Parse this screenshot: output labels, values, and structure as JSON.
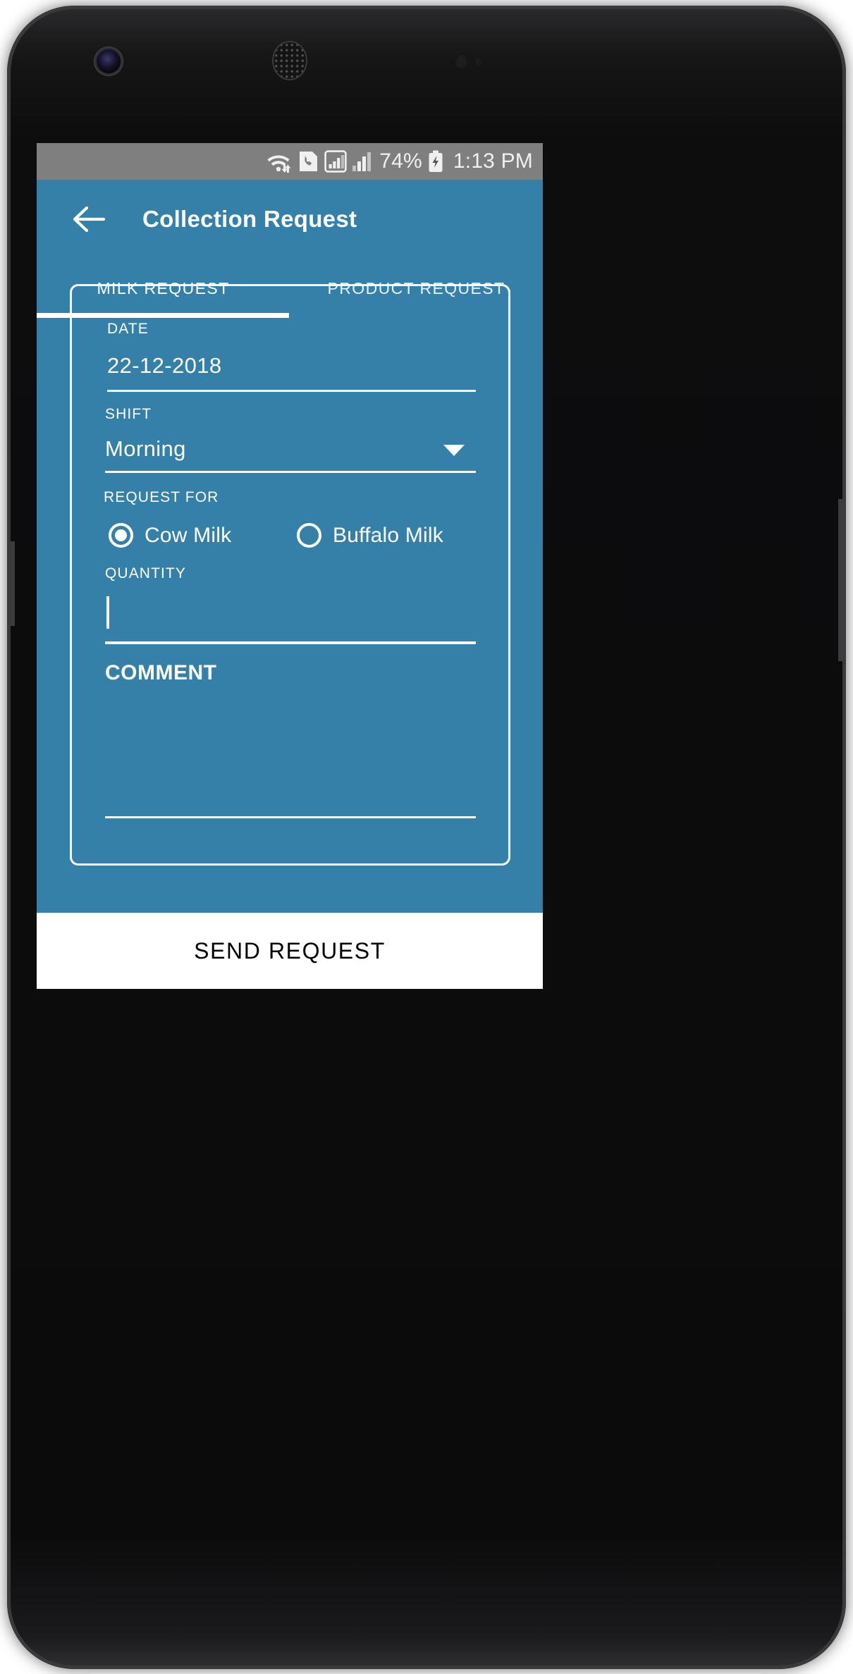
{
  "device": {
    "hardware": {
      "front_camera": "front-camera",
      "earpiece": "earpiece-speaker",
      "proximity_sensor": "proximity-sensor",
      "light_sensor": "light-sensor"
    }
  },
  "status_bar": {
    "wifi_icon": "wifi-transfer-icon",
    "call_icon": "phone-call-icon",
    "signal_icon_1": "signal-bars-boxed-icon",
    "signal_icon_2": "signal-bars-icon",
    "battery_percent": "74%",
    "battery_icon": "battery-charging-icon",
    "clock": "1:13 PM",
    "background": "#7f7f7f"
  },
  "app_bar": {
    "back_icon": "back-arrow-icon",
    "title": "Collection Request",
    "background": "#3580a8"
  },
  "tabs": {
    "active_index": 0,
    "items": [
      {
        "label": "MILK REQUEST"
      },
      {
        "label": "PRODUCT REQUEST"
      }
    ],
    "indicator_color": "#ffffff"
  },
  "form": {
    "date": {
      "label": "DATE",
      "value": "22-12-2018"
    },
    "shift": {
      "label": "SHIFT",
      "value": "Morning",
      "dropdown_icon": "chevron-down-icon",
      "options": [
        "Morning"
      ]
    },
    "request_for": {
      "label": "REQUEST FOR",
      "selected": "Cow Milk",
      "options": [
        {
          "label": "Cow Milk",
          "checked": true
        },
        {
          "label": "Buffalo Milk",
          "checked": false
        }
      ]
    },
    "quantity": {
      "label": "QUANTITY",
      "value": "",
      "focused": true
    },
    "comment": {
      "label": "COMMENT",
      "value": ""
    }
  },
  "footer": {
    "send_label": "SEND REQUEST",
    "background": "#ffffff",
    "text_color": "#000000"
  },
  "theme": {
    "accent": "#3580a8",
    "on_accent": "#ffffff"
  }
}
